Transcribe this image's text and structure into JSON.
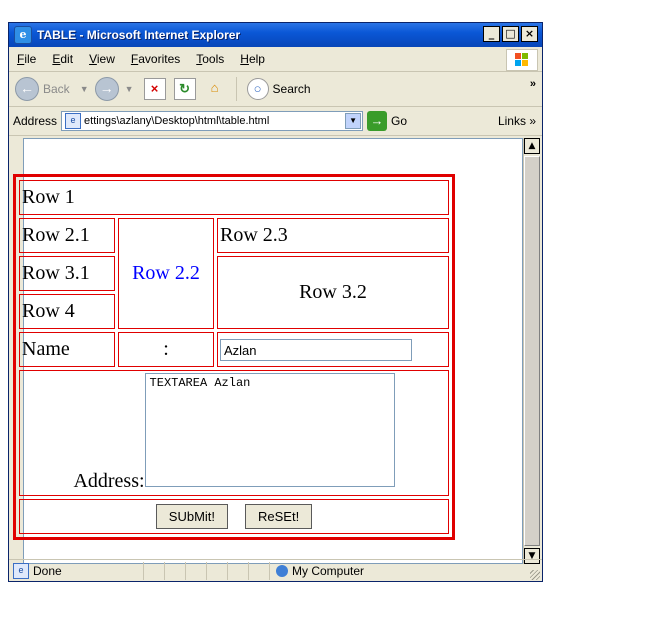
{
  "window": {
    "title": "TABLE - Microsoft Internet Explorer"
  },
  "menu": [
    "File",
    "Edit",
    "View",
    "Favorites",
    "Tools",
    "Help"
  ],
  "toolbar": {
    "back_label": "Back",
    "search_label": "Search"
  },
  "address": {
    "label": "Address",
    "url": "ettings\\azlany\\Desktop\\html\\table.html",
    "go_label": "Go",
    "links_label": "Links"
  },
  "page": {
    "row1": "Row 1",
    "row21": "Row 2.1",
    "row22": "Row 2.2",
    "row23": "Row 2.3",
    "row31": "Row 3.1",
    "row32": "Row 3.2",
    "row4": "Row 4",
    "name_label": "Name",
    "colon": ":",
    "name_value": "Azlan",
    "address_label": "Address:",
    "textarea_value": "TEXTAREA Azlan",
    "submit_label": "SUbMit!",
    "reset_label": "ReSEt!"
  },
  "status": {
    "text": "Done",
    "zone": "My Computer"
  },
  "colors": {
    "table_border": "#e00000",
    "highlight_text": "#0000ff",
    "title_bar": "#0a57d6"
  }
}
